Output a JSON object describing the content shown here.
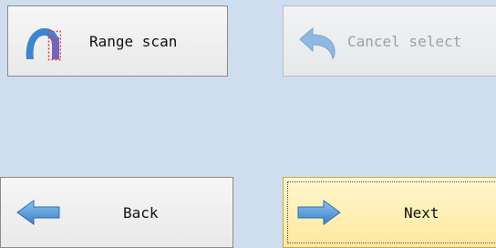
{
  "buttons": {
    "range_scan": {
      "label": "Range scan",
      "icon": "range-scan-icon"
    },
    "cancel_select": {
      "label": "Cancel select",
      "icon": "undo-arrow-icon",
      "enabled": false
    },
    "back": {
      "label": "Back",
      "icon": "arrow-left-icon"
    },
    "next": {
      "label": "Next",
      "icon": "arrow-right-icon",
      "focused": true
    }
  },
  "colors": {
    "background": "#cfdeef",
    "arrow_blue": "#4a90d0",
    "next_highlight": "#fde89d"
  }
}
